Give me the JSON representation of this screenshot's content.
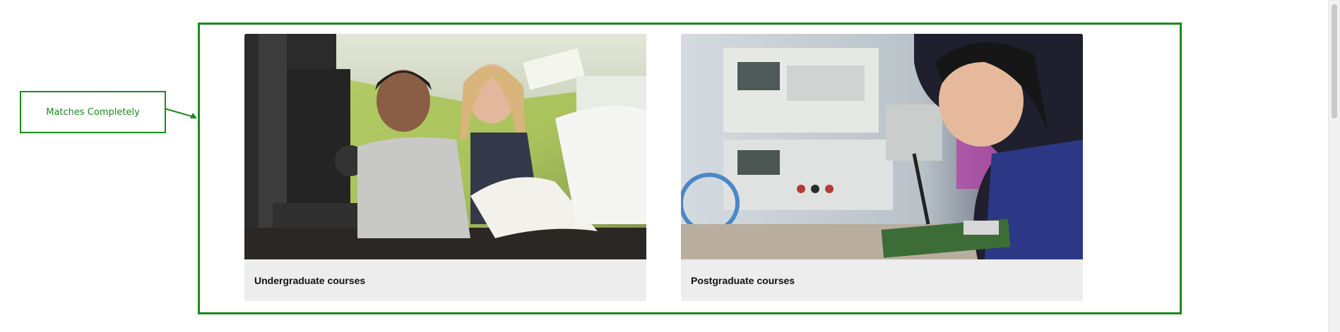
{
  "annotation": {
    "label": "Matches Completely",
    "color": "#1a8a1a"
  },
  "cards": [
    {
      "title": "Undergraduate courses",
      "image": "students-printing-press-photo"
    },
    {
      "title": "Postgraduate courses",
      "image": "student-soldering-electronics-photo"
    }
  ]
}
